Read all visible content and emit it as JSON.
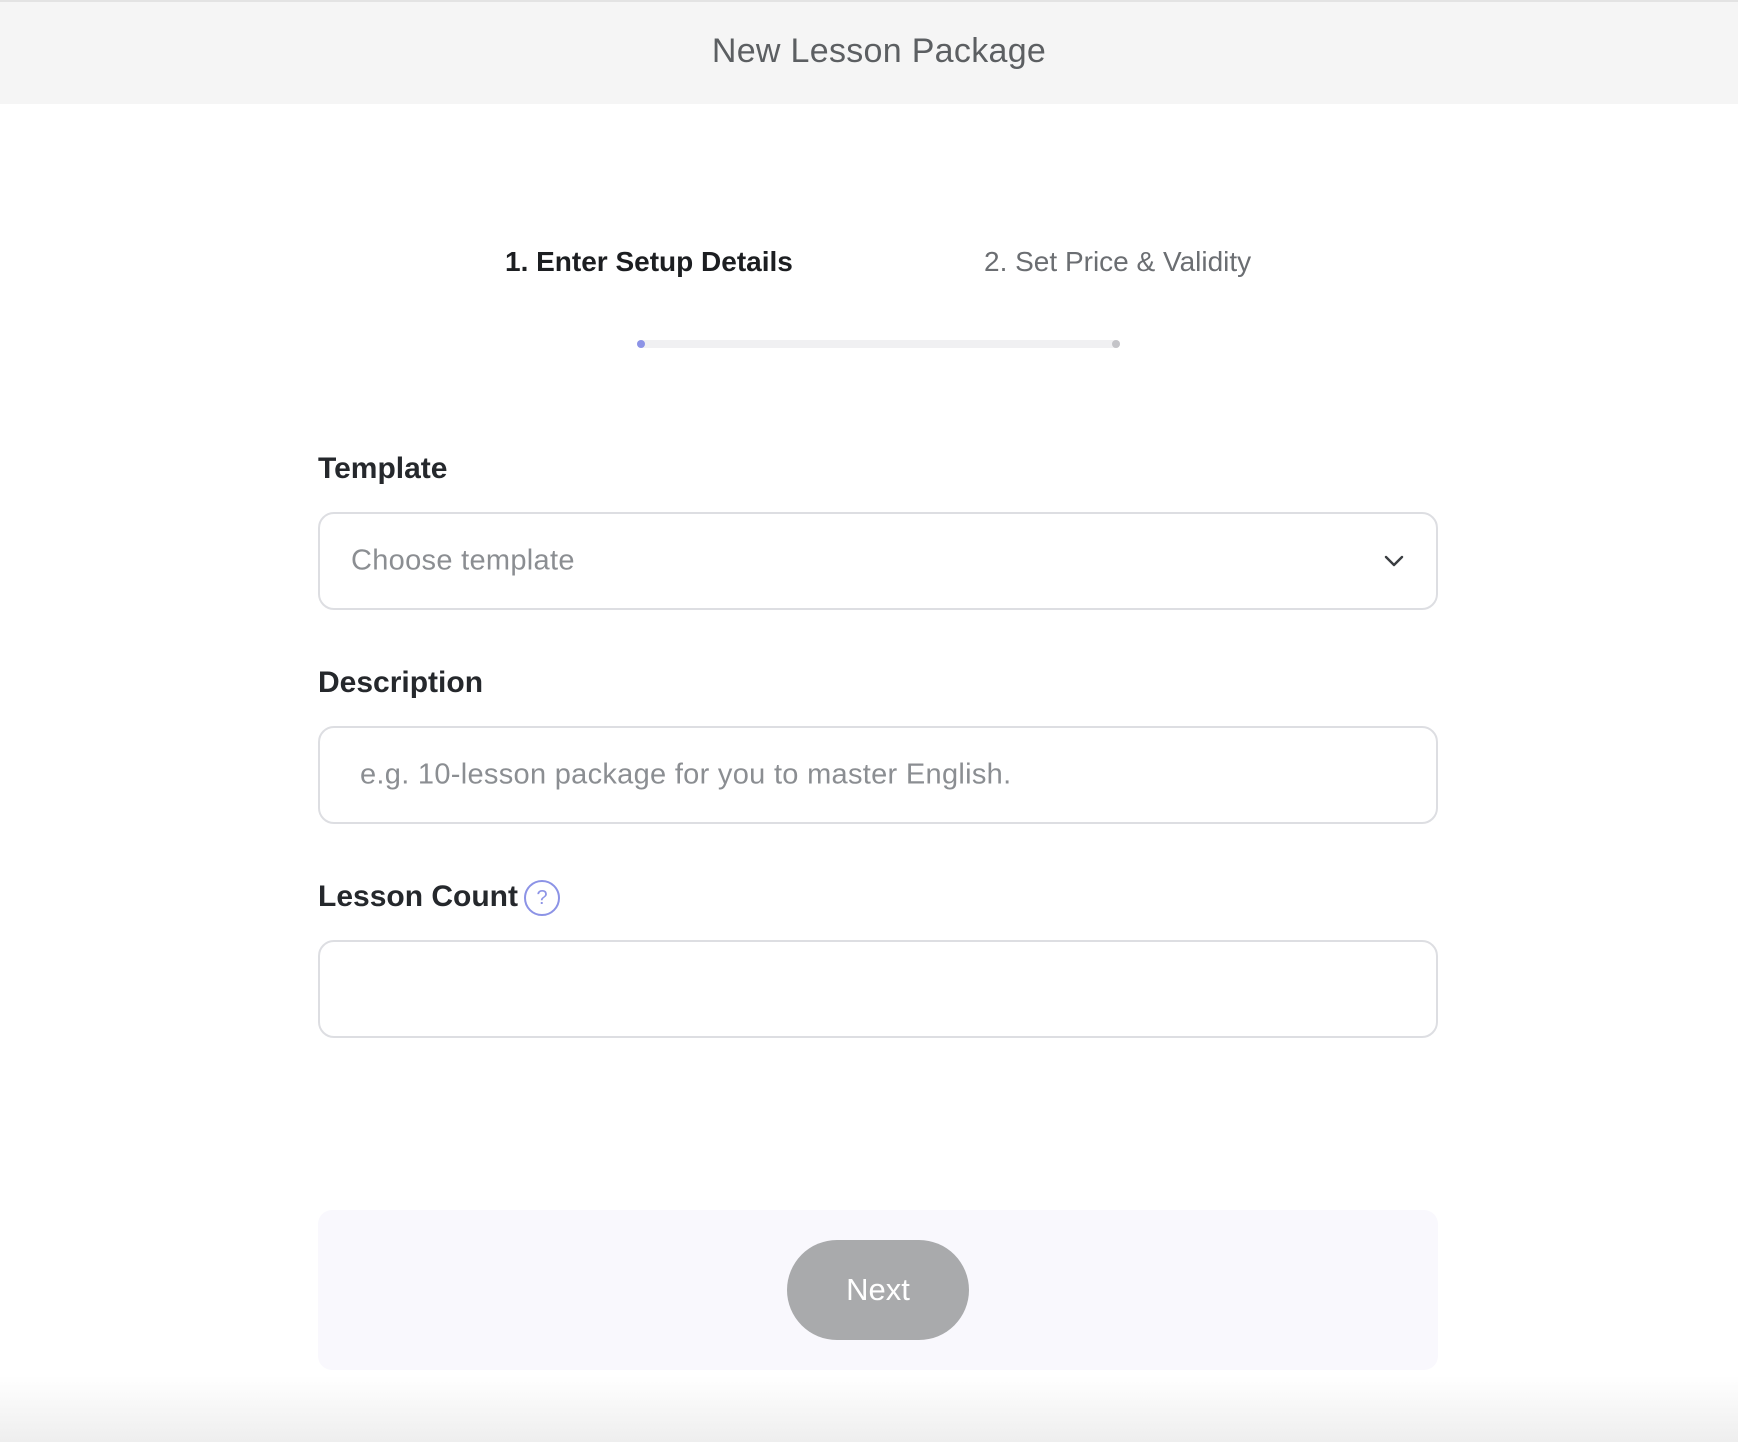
{
  "header": {
    "title": "New Lesson Package"
  },
  "steps": {
    "items": [
      {
        "label": "1. Enter Setup Details",
        "active": true
      },
      {
        "label": "2. Set Price & Validity",
        "active": false
      }
    ],
    "progress_fraction": 0.0
  },
  "form": {
    "template": {
      "label": "Template",
      "placeholder": "Choose template",
      "icon": "chevron-down-icon"
    },
    "description": {
      "label": "Description",
      "placeholder": "e.g. 10-lesson package for you to master English."
    },
    "lesson_count": {
      "label": "Lesson Count",
      "help_icon": "question-mark-icon",
      "help_glyph": "?",
      "value": ""
    }
  },
  "footer": {
    "next_label": "Next"
  },
  "colors": {
    "accent": "#8c93e6",
    "button_disabled": "#a9aaac",
    "header_bg": "#f5f5f5",
    "footer_panel_bg": "#f9f8fd"
  }
}
